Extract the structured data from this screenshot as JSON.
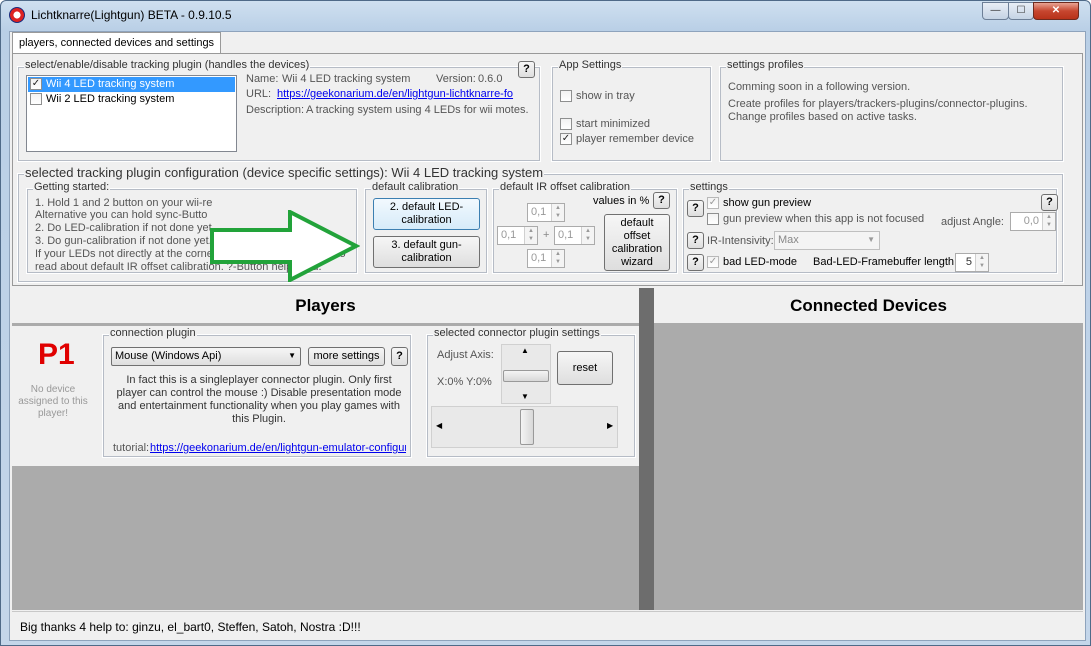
{
  "window": {
    "title": "Lichtknarre(Lightgun) BETA - 0.9.10.5",
    "min_glyph": "—",
    "max_glyph": "☐",
    "close_glyph": "✕"
  },
  "tabs": [
    {
      "label": "players, connected devices and settings"
    }
  ],
  "plugin_select": {
    "legend": "select/enable/disable tracking plugin (handles the devices)",
    "items": [
      {
        "label": "Wii 4 LED tracking system",
        "checked": true,
        "selected": true
      },
      {
        "label": "Wii 2 LED tracking system",
        "checked": false,
        "selected": false
      }
    ],
    "name_label": "Name:",
    "name_value": "Wii 4 LED tracking system",
    "version_label": "Version:",
    "version_value": "0.6.0",
    "url_label": "URL:",
    "url_value": "https://geekonarium.de/en/lightgun-lichtknarre-fo",
    "description_label": "Description:",
    "description_value": "A tracking system using 4 LEDs for wii motes.",
    "help": "?"
  },
  "app_settings": {
    "legend": "App Settings",
    "show_in_tray": "show in tray",
    "start_minimized": "start minimized",
    "player_remember_device": "player remember device"
  },
  "settings_profiles": {
    "legend": "settings profiles",
    "line1": "Comming soon in a following version.",
    "line2": "Create profiles for players/trackers-plugins/connector-plugins.",
    "line3": "Change profiles based on active tasks."
  },
  "plugin_config": {
    "legend": "selected tracking plugin configuration (device specific settings): Wii 4 LED tracking system",
    "getting_started": {
      "legend": "Getting started:",
      "lines": [
        "1. Hold 1 and 2 button on your wii-re",
        "Alternative you can hold sync-Butto",
        "2. Do LED-calibration if not done yet.",
        "3. Do gun-calibration if not done yet.",
        "If your LEDs not directly at the corners of the screen consider to",
        "read about default IR offset calibration. ?-Button helps you."
      ]
    },
    "default_calibration": {
      "legend": "default calibration",
      "led_button": "2. default LED-calibration",
      "gun_button": "3. default gun-calibration"
    },
    "ir_offset": {
      "legend": "default IR offset calibration",
      "values_label": "values in %",
      "top": "0,1",
      "left": "0,1",
      "right": "0,1",
      "bottom": "0,1",
      "plus": "+",
      "wizard_button": "default offset calibration wizard",
      "help": "?"
    },
    "settings": {
      "legend": "settings",
      "show_gun_preview": "show gun preview",
      "gun_preview_unfocused": "gun preview when this app is not focused",
      "adjust_angle_label": "adjust Angle:",
      "adjust_angle_value": "0,0",
      "ir_intensity_label": "IR-Intensivity:",
      "ir_intensity_value": "Max",
      "bad_led_mode": "bad LED-mode",
      "bad_led_buffer_label": "Bad-LED-Framebuffer length:",
      "bad_led_buffer_value": "5",
      "help": "?"
    }
  },
  "players": {
    "header": "Players",
    "connected_header": "Connected Devices",
    "p1": {
      "label": "P1",
      "no_device": "No device assigned to this player!",
      "connection_plugin": {
        "legend": "connection plugin",
        "selected": "Mouse (Windows Api)",
        "more_settings": "more settings",
        "help": "?",
        "description": "In fact this is a singleplayer connector plugin. Only first player can control the mouse :) Disable presentation mode and entertainment functionality when you play games with this Plugin.",
        "tutorial_label": "tutorial:",
        "tutorial_url": "https://geekonarium.de/en/lightgun-emulator-configur"
      },
      "connector_settings": {
        "legend": "selected connector plugin settings",
        "adjust_axis": "Adjust Axis:",
        "xy_readout": "X:0% Y:0%",
        "reset": "reset"
      }
    }
  },
  "status": {
    "text": "Big thanks 4 help to: ginzu, el_bart0, Steffen, Satoh, Nostra :D!!!"
  },
  "colors": {
    "arrow_fill": "#ffffff",
    "arrow_stroke": "#22a33a",
    "p1_color": "#e00000",
    "selected_bg": "#3399ff"
  }
}
